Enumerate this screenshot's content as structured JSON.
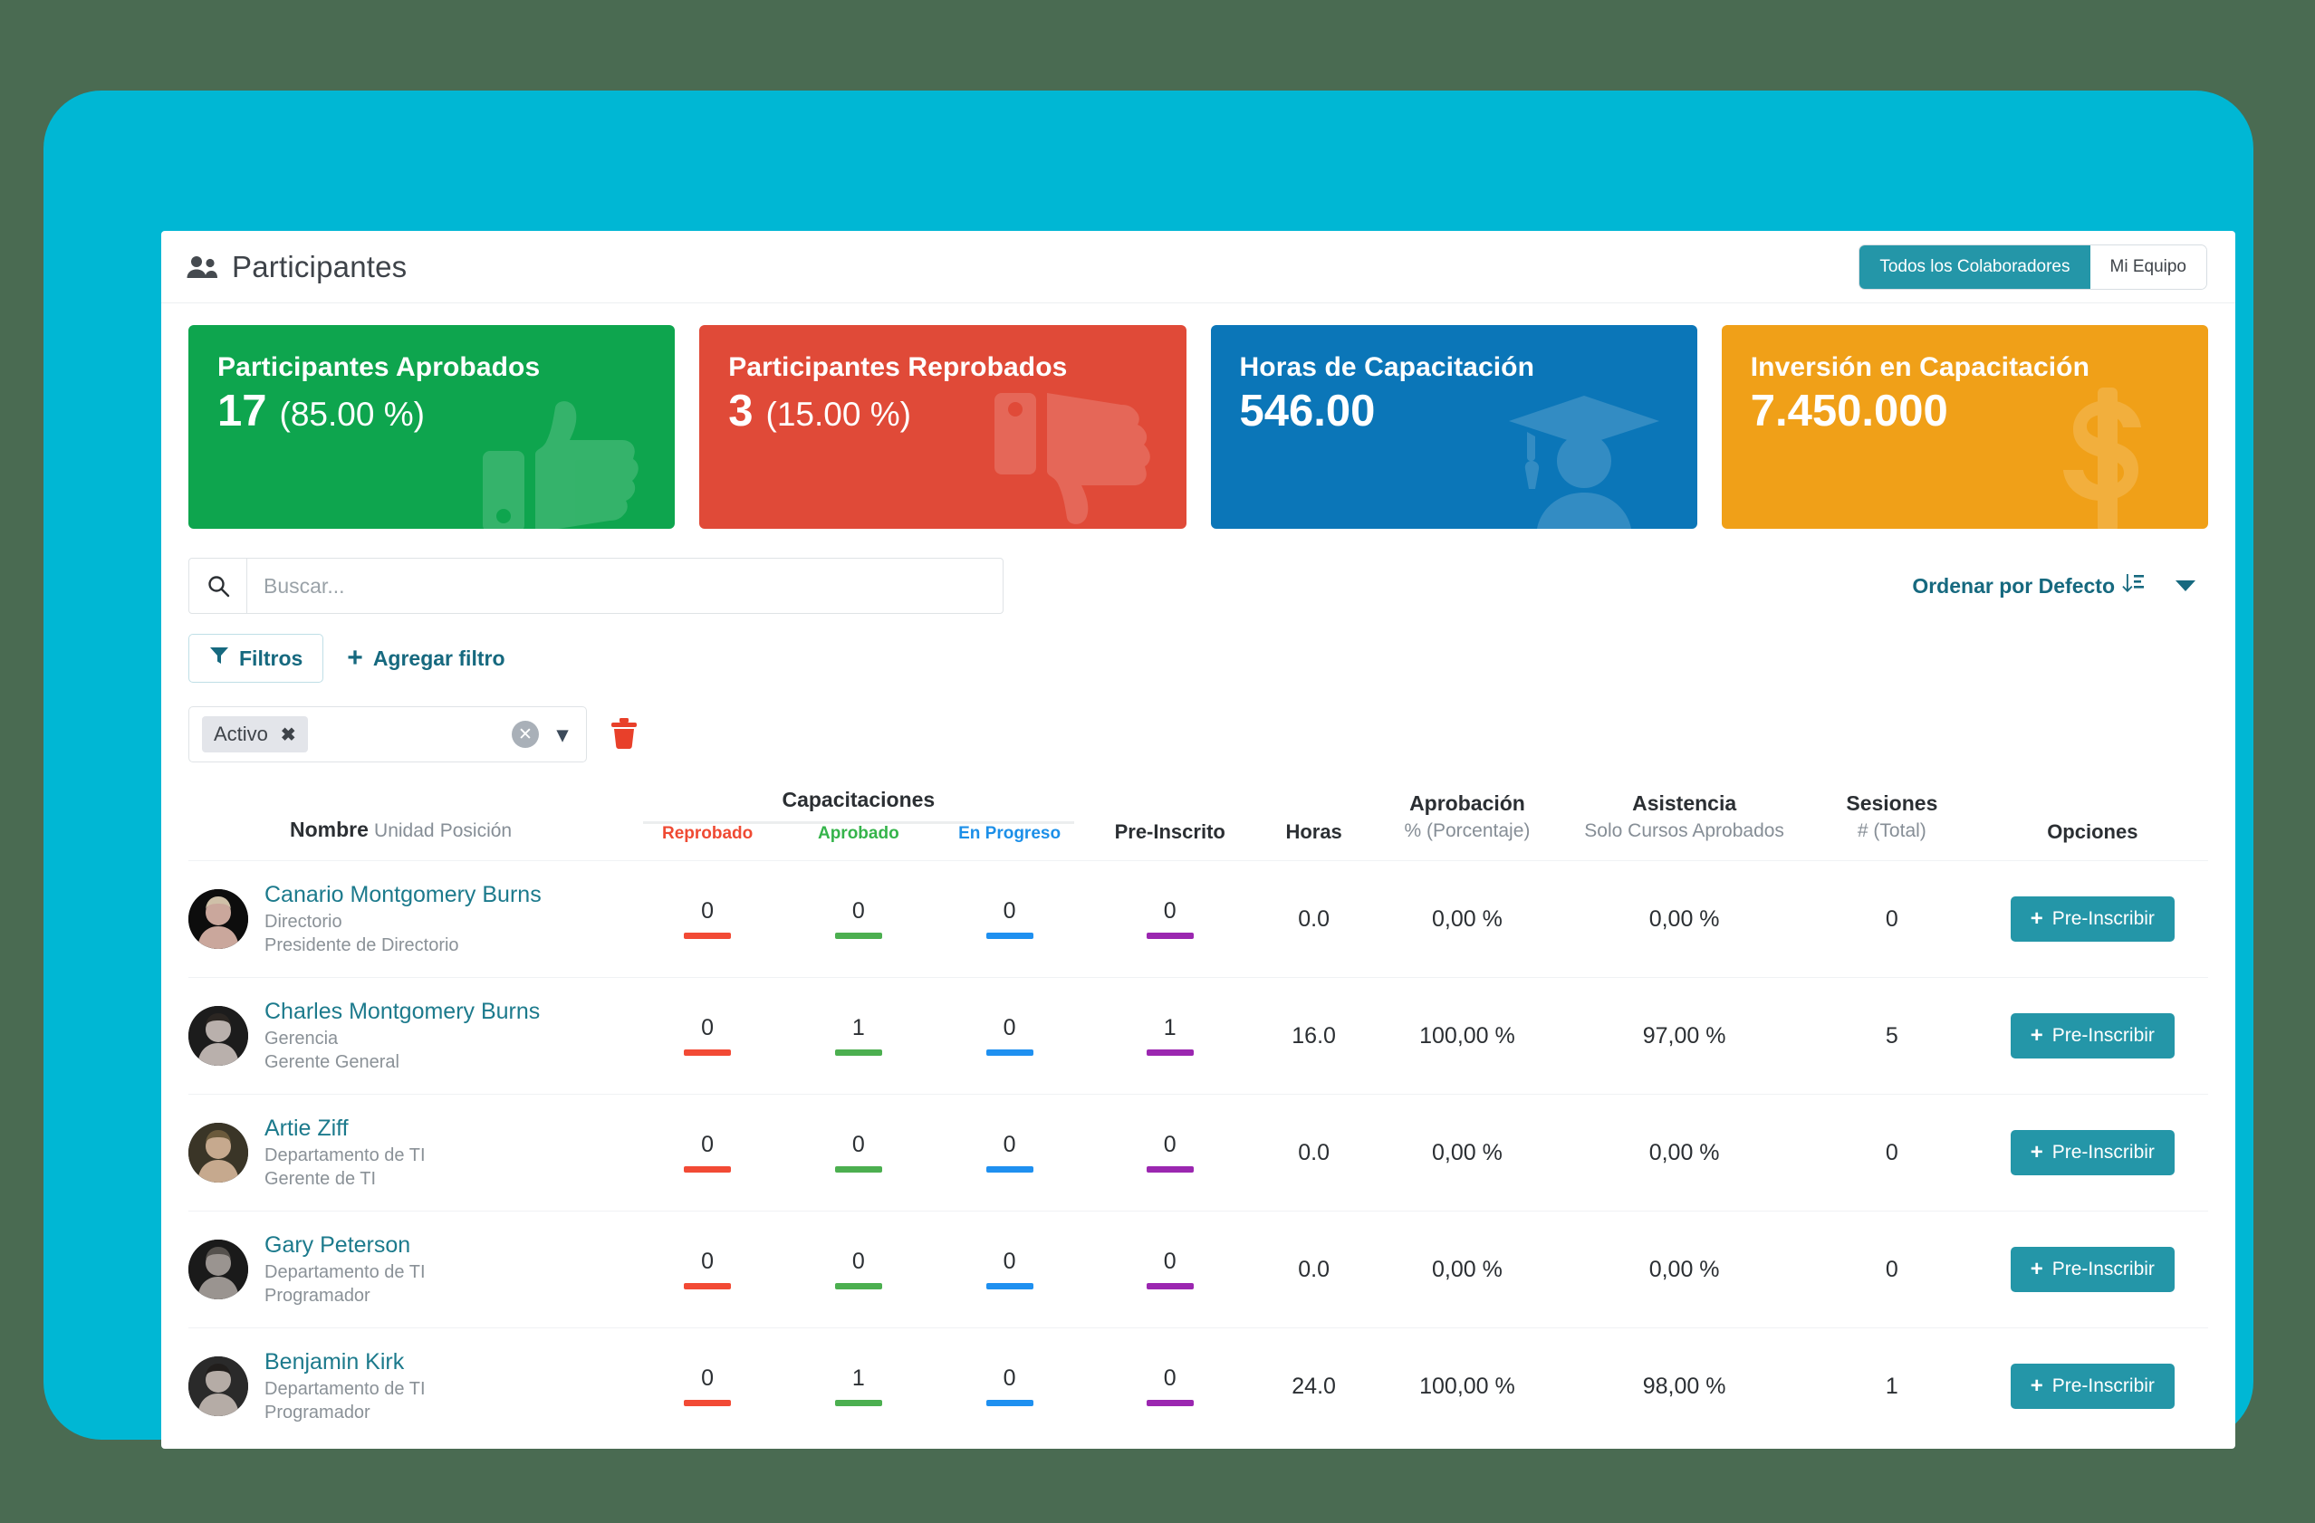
{
  "header": {
    "title": "Participantes",
    "people_icon": "people-icon",
    "toggles": [
      {
        "label": "Todos los Colaboradores",
        "active": true
      },
      {
        "label": "Mi Equipo",
        "active": false
      }
    ]
  },
  "kpis": [
    {
      "title": "Participantes Aprobados",
      "value": "17",
      "sub": "(85.00 %)",
      "color": "#0ea54e",
      "icon": "thumbs-up-icon"
    },
    {
      "title": "Participantes Reprobados",
      "value": "3",
      "sub": "(15.00 %)",
      "color": "#e04a38",
      "icon": "thumbs-down-icon"
    },
    {
      "title": "Horas de Capacitación",
      "value": "546.00",
      "sub": "",
      "color": "#0b76b8",
      "icon": "graduate-icon"
    },
    {
      "title": "Inversión en Capacitación",
      "value": "7.450.000",
      "sub": "",
      "color": "#f0a018",
      "icon": "dollar-icon"
    }
  ],
  "search": {
    "placeholder": "Buscar...",
    "value": "",
    "icon": "search-icon"
  },
  "sort": {
    "label": "Ordenar por Defecto",
    "icon": "sort-descending-icon",
    "caret": "chevron-down-icon"
  },
  "filters": {
    "filtros_label": "Filtros",
    "filtros_icon": "funnel-icon",
    "add_filter_label": "Agregar filtro",
    "add_filter_icon": "plus-icon",
    "chip": {
      "label": "Activo",
      "remove_icon": "close-icon"
    },
    "clear_icon": "clear-circle-icon",
    "dropdown_icon": "chevron-down-icon",
    "delete_icon": "trash-icon"
  },
  "table": {
    "headers": {
      "nombre": "Nombre",
      "nombre_sub1": "Unidad",
      "nombre_sub2": "Posición",
      "capacitaciones": "Capacitaciones",
      "reprobado": "Reprobado",
      "aprobado": "Aprobado",
      "en_progreso": "En Progreso",
      "pre_inscrito": "Pre-Inscrito",
      "horas": "Horas",
      "aprobacion": "Aprobación",
      "aprobacion_sub": "% (Porcentaje)",
      "asistencia": "Asistencia",
      "asistencia_sub": "Solo Cursos Aprobados",
      "sesiones": "Sesiones",
      "sesiones_sub": "# (Total)",
      "opciones": "Opciones"
    },
    "action_label": "Pre-Inscribir",
    "action_icon": "plus-icon",
    "rows": [
      {
        "name": "Canario Montgomery Burns",
        "unit": "Directorio",
        "position": "Presidente de Directorio",
        "reprobado": "0",
        "aprobado": "0",
        "en_progreso": "0",
        "pre_inscrito": "0",
        "horas": "0.0",
        "aprobacion": "0,00 %",
        "asistencia": "0,00 %",
        "sesiones": "0",
        "avatar": "avatar-woman-short-blonde-hair"
      },
      {
        "name": "Charles Montgomery Burns",
        "unit": "Gerencia",
        "position": "Gerente General",
        "reprobado": "0",
        "aprobado": "1",
        "en_progreso": "0",
        "pre_inscrito": "1",
        "horas": "16.0",
        "aprobacion": "100,00 %",
        "asistencia": "97,00 %",
        "sesiones": "5",
        "avatar": "avatar-woman-dark-curly-hair"
      },
      {
        "name": "Artie Ziff",
        "unit": "Departamento de TI",
        "position": "Gerente de TI",
        "reprobado": "0",
        "aprobado": "0",
        "en_progreso": "0",
        "pre_inscrito": "0",
        "horas": "0.0",
        "aprobacion": "0,00 %",
        "asistencia": "0,00 %",
        "sesiones": "0",
        "avatar": "avatar-young-girl-brown-hair"
      },
      {
        "name": "Gary Peterson",
        "unit": "Departamento de TI",
        "position": "Programador",
        "reprobado": "0",
        "aprobado": "0",
        "en_progreso": "0",
        "pre_inscrito": "0",
        "horas": "0.0",
        "aprobacion": "0,00 %",
        "asistencia": "0,00 %",
        "sesiones": "0",
        "avatar": "avatar-elderly-man-bw"
      },
      {
        "name": "Benjamin Kirk",
        "unit": "Departamento de TI",
        "position": "Programador",
        "reprobado": "0",
        "aprobado": "1",
        "en_progreso": "0",
        "pre_inscrito": "0",
        "horas": "24.0",
        "aprobacion": "100,00 %",
        "asistencia": "98,00 %",
        "sesiones": "1",
        "avatar": "avatar-child-bw"
      }
    ]
  },
  "theme": {
    "frame": "#00b7d4",
    "page_background": "#4a6b52",
    "accent_teal": "#2496a8",
    "link_teal": "#1c7a8c",
    "bar_reprobado": "#f24a35",
    "bar_aprobado": "#4caf50",
    "bar_progreso": "#1f90f0",
    "bar_preinscrito": "#9b27b0"
  }
}
